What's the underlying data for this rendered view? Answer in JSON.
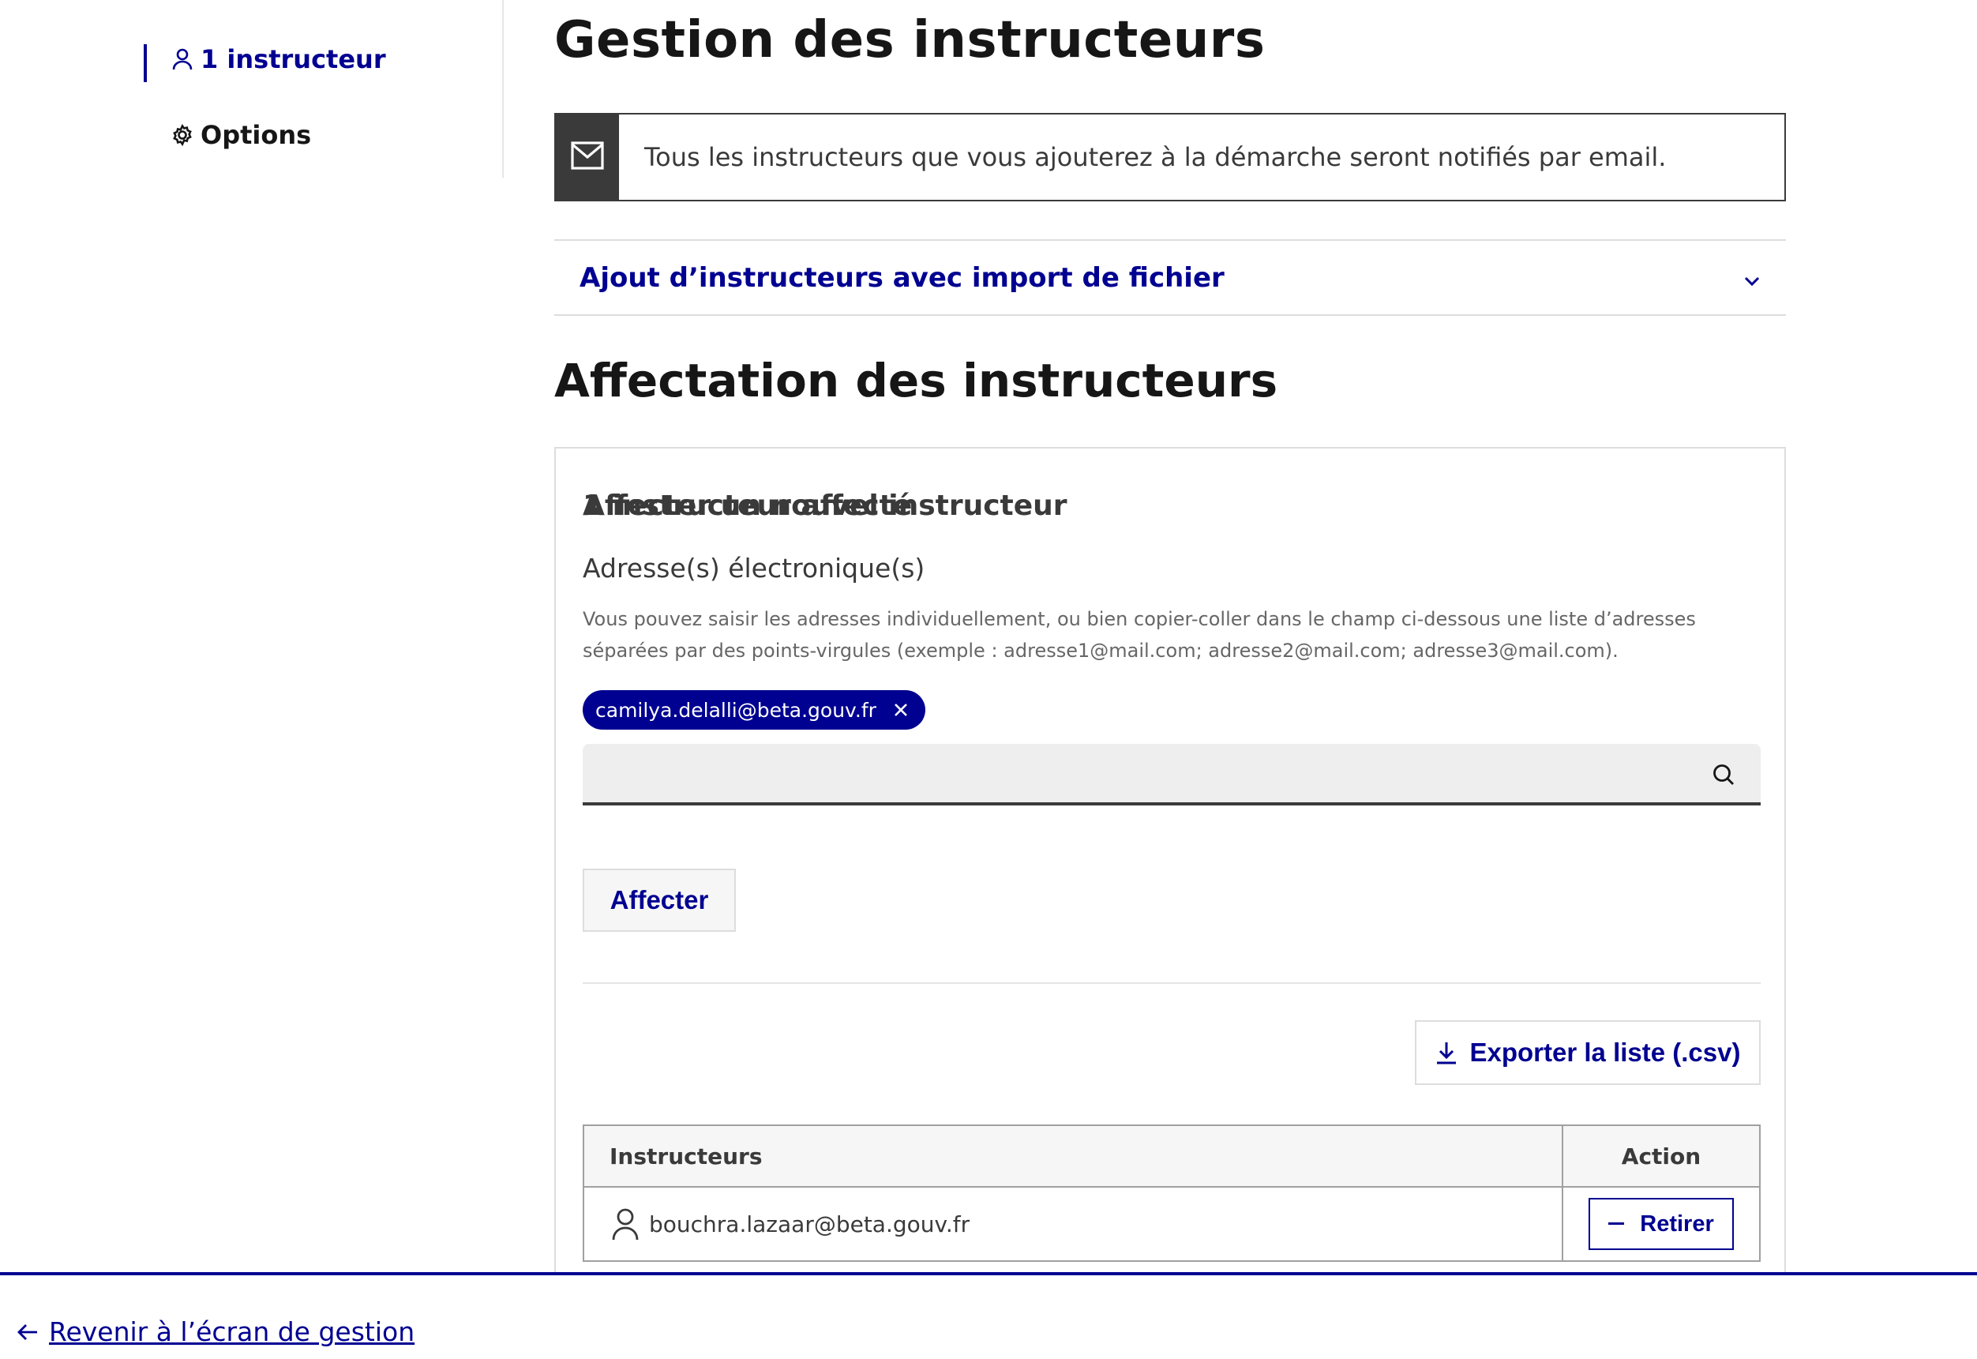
{
  "sidebar": {
    "items": [
      {
        "label": "1 instructeur",
        "icon": "user-icon",
        "active": true
      },
      {
        "label": "Options",
        "icon": "gear-icon",
        "active": false
      }
    ]
  },
  "main": {
    "title": "Gestion des instructeurs",
    "notice": {
      "icon": "mail-icon",
      "text": "Tous les instructeurs que vous ajouterez à la démarche seront notifiés par email."
    },
    "accordion": {
      "label": "Ajout d’instructeurs avec import de fichier",
      "icon": "chevron-down-icon"
    },
    "section_title": "Affectation des instructeurs",
    "form": {
      "heading": "Affecter un nouvel instructeur",
      "field_label": "Adresse(s) électronique(s)",
      "hint": "Vous pouvez saisir les adresses individuellement, ou bien copier-coller dans le champ ci-dessous une liste d’adresses séparées par des points-virgules (exemple : adresse1@mail.com; adresse2@mail.com; adresse3@mail.com).",
      "selected_tags": [
        "camilya.delalli@beta.gouv.fr"
      ],
      "search_value": "",
      "search_placeholder": "",
      "submit_label": "Affecter"
    },
    "assigned": {
      "count_label": "1 instructeur affecté",
      "export_label": "Exporter la liste (.csv)",
      "table": {
        "columns": [
          "Instructeurs",
          "Action"
        ],
        "rows": [
          {
            "email": "bouchra.lazaar@beta.gouv.fr",
            "action_label": "Retirer"
          }
        ]
      }
    }
  },
  "footer": {
    "back_label": "Revenir à l’écran de gestion"
  },
  "colors": {
    "primary": "#000091",
    "text": "#161616",
    "notice_bar": "#3a3a3a",
    "border": "#dddddd"
  }
}
